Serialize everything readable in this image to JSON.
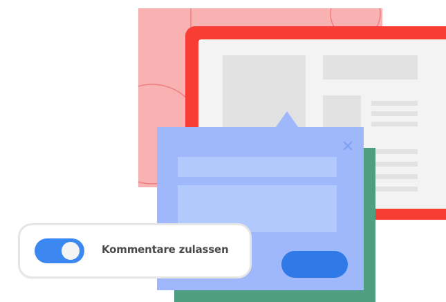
{
  "colors": {
    "pink_panel": "#f9b2b2",
    "red_frame": "#f83d34",
    "window_bg": "#f3f3f3",
    "placeholder": "#e2e2e2",
    "green_panel": "#4f9e80",
    "dialog_bg": "#9fb8fb",
    "field_bg": "#b1c9fc",
    "button_bg": "#2f7ae6",
    "toggle_on": "#3d87f0"
  },
  "dialog": {
    "close_icon": "close-icon",
    "submit_label": ""
  },
  "comment_toggle": {
    "label": "Kommentare zulassen",
    "state": "on"
  }
}
